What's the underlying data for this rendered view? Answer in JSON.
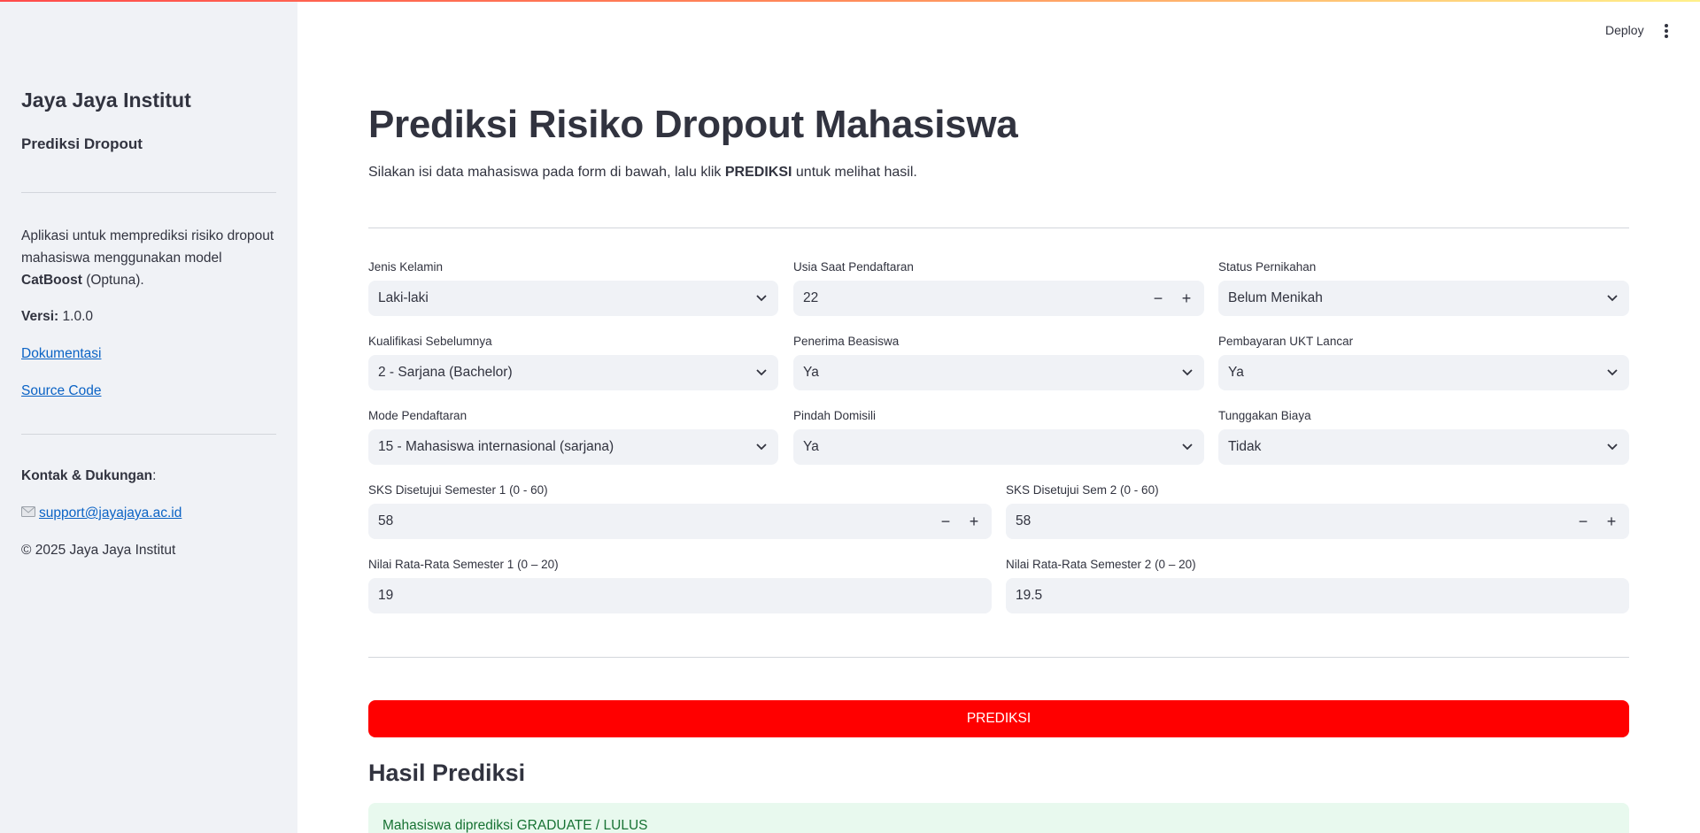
{
  "header": {
    "deploy_label": "Deploy",
    "menu_icon": "vertical-dots-icon"
  },
  "sidebar": {
    "title": "Jaya Jaya Institut",
    "subtitle": "Prediksi Dropout",
    "description_pre": "Aplikasi untuk memprediksi risiko dropout mahasiswa menggunakan model ",
    "description_bold": "CatBoost",
    "description_post": " (Optuna).",
    "version_label": "Versi:",
    "version_value": "1.0.0",
    "docs_link": "Dokumentasi",
    "source_link": "Source Code",
    "contact_label": "Kontak & Dukungan",
    "contact_colon": ":",
    "email_icon": "envelope-icon",
    "email": "support@jayajaya.ac.id",
    "copyright": "© 2025 Jaya Jaya Institut"
  },
  "main": {
    "title": "Prediksi Risiko Dropout Mahasiswa",
    "intro_pre": "Silakan isi data mahasiswa pada form di bawah, lalu klik ",
    "intro_bold": "PREDIKSI",
    "intro_post": " untuk melihat hasil.",
    "fields": {
      "jenis_kelamin": {
        "label": "Jenis Kelamin",
        "value": "Laki-laki"
      },
      "usia": {
        "label": "Usia Saat Pendaftaran",
        "value": "22"
      },
      "status_pernikahan": {
        "label": "Status Pernikahan",
        "value": "Belum Menikah"
      },
      "kualifikasi": {
        "label": "Kualifikasi Sebelumnya",
        "value": "2 - Sarjana (Bachelor)"
      },
      "beasiswa": {
        "label": "Penerima Beasiswa",
        "value": "Ya"
      },
      "ukt": {
        "label": "Pembayaran UKT Lancar",
        "value": "Ya"
      },
      "mode": {
        "label": "Mode Pendaftaran",
        "value": "15 - Mahasiswa internasional (sarjana)"
      },
      "domisili": {
        "label": "Pindah Domisili",
        "value": "Ya"
      },
      "tunggakan": {
        "label": "Tunggakan Biaya",
        "value": "Tidak"
      },
      "sks1": {
        "label": "SKS Disetujui Semester 1 (0 - 60)",
        "value": "58"
      },
      "sks2": {
        "label": "SKS Disetujui Sem 2 (0 - 60)",
        "value": "58"
      },
      "nilai1": {
        "label": "Nilai Rata-Rata Semester 1 (0 – 20)",
        "value": "19"
      },
      "nilai2": {
        "label": "Nilai Rata-Rata Semester 2 (0 – 20)",
        "value": "19.5"
      }
    },
    "stepper_minus": "−",
    "stepper_plus": "+",
    "predict_button": "PREDIKSI",
    "result_title": "Hasil Prediksi",
    "result_message": "Mahasiswa diprediksi GRADUATE / LULUS"
  }
}
